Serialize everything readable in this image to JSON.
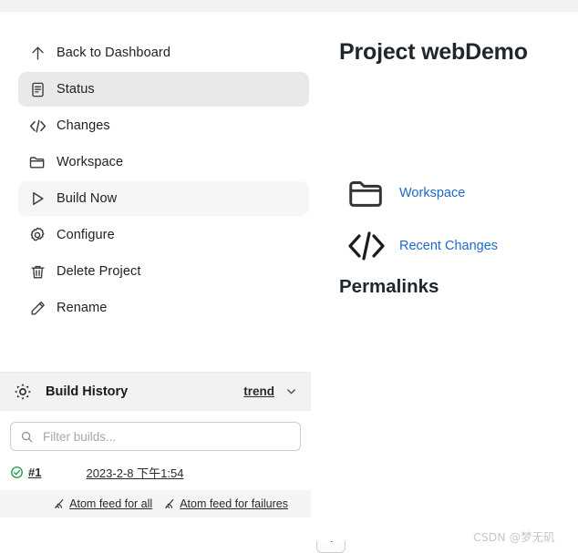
{
  "sidebar": {
    "items": [
      {
        "label": "Back to Dashboard",
        "icon": "arrow-up-icon",
        "state": "normal",
        "name": "back-to-dashboard"
      },
      {
        "label": "Status",
        "icon": "document-icon",
        "state": "selected",
        "name": "status"
      },
      {
        "label": "Changes",
        "icon": "code-icon",
        "state": "normal",
        "name": "changes"
      },
      {
        "label": "Workspace",
        "icon": "folder-icon",
        "state": "normal",
        "name": "workspace"
      },
      {
        "label": "Build Now",
        "icon": "play-icon",
        "state": "hovered",
        "name": "build-now"
      },
      {
        "label": "Configure",
        "icon": "gear-icon",
        "state": "normal",
        "name": "configure"
      },
      {
        "label": "Delete Project",
        "icon": "trash-icon",
        "state": "normal",
        "name": "delete-project"
      },
      {
        "label": "Rename",
        "icon": "pencil-icon",
        "state": "normal",
        "name": "rename"
      }
    ]
  },
  "build_history": {
    "icon": "weather-sun-icon",
    "title": "Build History",
    "trend_label": "trend",
    "chevron_icon": "chevron-down-icon",
    "filter": {
      "icon": "search-icon",
      "value": "",
      "placeholder": "Filter builds..."
    },
    "builds": [
      {
        "status_icon": "success-check-icon",
        "status_color": "#1a9641",
        "number": "#1",
        "time": "2023-2-8 下午1:54"
      }
    ],
    "feeds": [
      {
        "icon": "rss-icon",
        "label": "Atom feed for all"
      },
      {
        "icon": "rss-icon",
        "label": "Atom feed for failures"
      }
    ],
    "scroll_buttons": [
      {
        "icon": "jump-to-top-icon",
        "name": "scroll-to-top-button"
      },
      {
        "icon": "arrow-up-icon",
        "name": "scroll-up-button"
      },
      {
        "icon": "arrow-down-icon",
        "name": "scroll-down-button"
      }
    ]
  },
  "main": {
    "title": "Project webDemo",
    "links": [
      {
        "icon": "folder-icon",
        "label": "Workspace"
      },
      {
        "icon": "code-icon",
        "label": "Recent Changes"
      }
    ],
    "permalinks_title": "Permalinks"
  },
  "watermark": "CSDN @梦无矶",
  "colors": {
    "link": "#1b6ac9",
    "selected_bg": "#e9e9e9",
    "hover_bg": "#f6f6f6",
    "header_bg": "#f2f2f2",
    "success": "#1a9641"
  }
}
